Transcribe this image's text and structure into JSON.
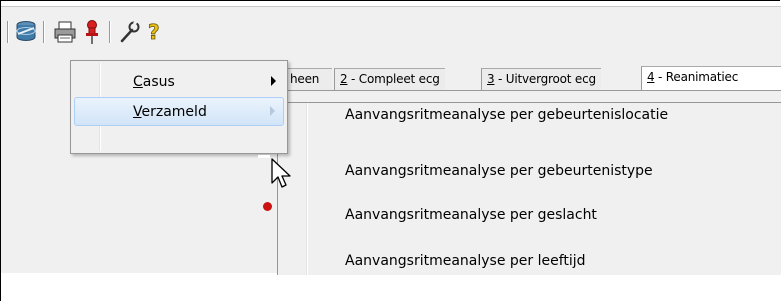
{
  "toolbar": {
    "buttons": [
      {
        "icon": "database-cylinder-icon"
      },
      {
        "icon": "printer-icon"
      },
      {
        "icon": "red-pushpin-icon"
      },
      {
        "icon": "wrench-icon"
      },
      {
        "icon": "question-mark-help-icon"
      }
    ]
  },
  "tabs": [
    {
      "label": "heen"
    },
    {
      "num": "2",
      "label": " - Compleet ecg"
    },
    {
      "num": "3",
      "label": " - Uitvergroot ecg"
    },
    {
      "num": "4",
      "label": " - Reanimatiec"
    }
  ],
  "menu": {
    "items": [
      {
        "first": "C",
        "rest": "asus"
      },
      {
        "first": "V",
        "rest": "erzameld"
      }
    ]
  },
  "submenu": {
    "items": [
      "Aanvangsritmeanalyse per gebeurtenislocatie",
      "Aanvangsritmeanalyse per gebeurtenistype",
      "Aanvangsritmeanalyse per geslacht",
      "Aanvangsritmeanalyse per leeftijd"
    ]
  },
  "colors": {
    "menu_bg": "#f0f0f0",
    "highlight_top": "#eaf3fc",
    "highlight_bottom": "#d2e5f8",
    "highlight_border": "#aecff7",
    "pin_red": "#cc1111"
  }
}
